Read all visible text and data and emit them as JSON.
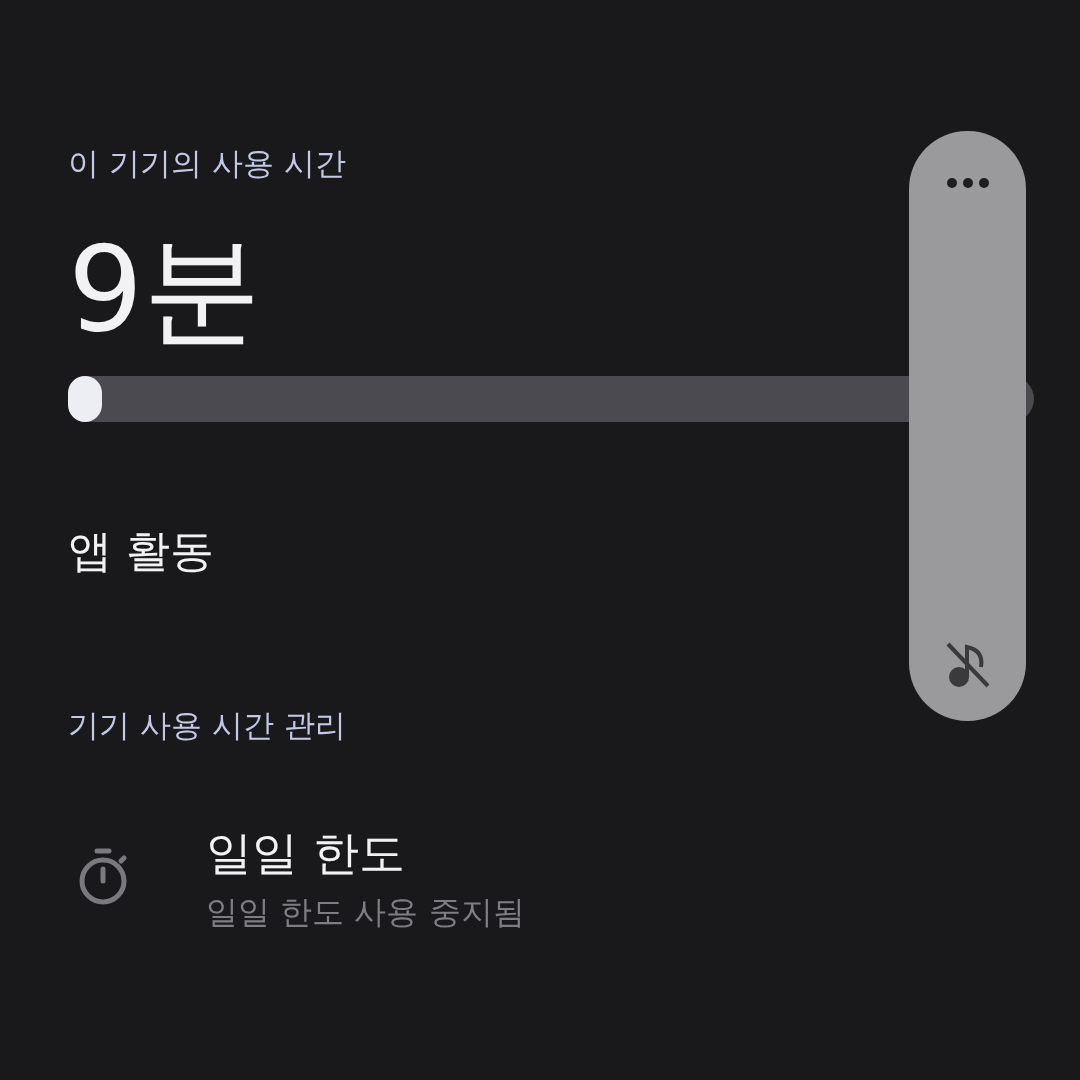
{
  "usage": {
    "label": "이 기기의 사용 시간",
    "total": "9분",
    "level": 0.03
  },
  "app_activity": {
    "title": "앱 활동"
  },
  "management": {
    "label": "기기 사용 시간 관리",
    "items": [
      {
        "kind": "timer",
        "title": "일일 한도",
        "subtitle": "일일 한도 사용 중지됨",
        "disabled": true
      }
    ]
  },
  "edge_panel": {
    "open": true
  }
}
